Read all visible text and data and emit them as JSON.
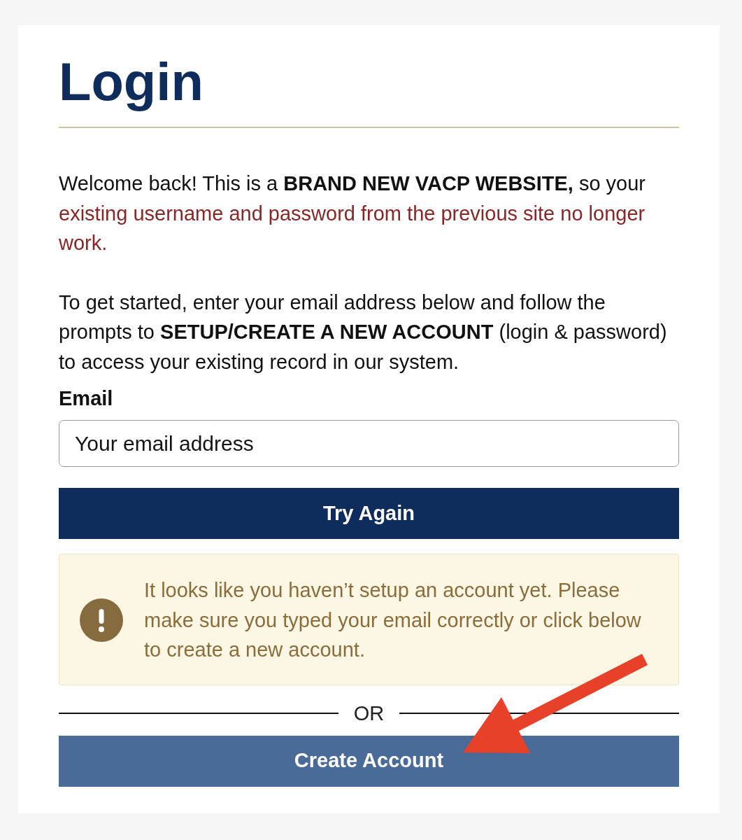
{
  "page": {
    "title": "Login"
  },
  "intro": {
    "text": "Welcome back! This is a **BRAND NEW VACP WEBSITE,** so your",
    "notice": "existing username and password from the previous site no longer work."
  },
  "instructions": "To get started, enter your email address below and follow the prompts to **SETUP/CREATE A NEW ACCOUNT** (login & password) to access your existing record in our system.",
  "email_field": {
    "label": "Email",
    "placeholder": "Your email address"
  },
  "submit_button": {
    "label": "Try Again",
    "kind": "primary"
  },
  "alert": {
    "kind": "warning",
    "text": "It looks like you haven’t setup an account yet. Please make sure you typed your email correctly or click below to create a new account."
  },
  "separator": {
    "label": "OR"
  },
  "create_button": {
    "label": "Create Account",
    "kind": "secondary"
  }
}
